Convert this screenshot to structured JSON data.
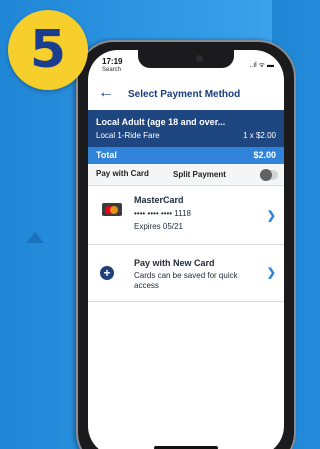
{
  "badge": {
    "number": "5"
  },
  "status": {
    "time": "17:19",
    "back_app": "Search",
    "icons": "..ıl ᯤ ▬"
  },
  "nav": {
    "back_icon": "arrow-left-icon",
    "title": "Select Payment Method"
  },
  "fare": {
    "name": "Local Adult (age 18 and over...",
    "type": "Local 1-Ride Fare",
    "qty_price": "1 x $2.00"
  },
  "total": {
    "label": "Total",
    "amount": "$2.00"
  },
  "payment": {
    "pay_with_card": "Pay with Card",
    "split_payment": "Split Payment",
    "split_enabled": false
  },
  "card": {
    "brand": "MasterCard",
    "number": "•••• •••• •••• 1118",
    "expires": "Expires 05/21",
    "icon": "mastercard-logo-icon"
  },
  "new_card": {
    "title": "Pay with New Card",
    "subtitle": "Cards can be saved for quick access",
    "icon": "plus-circle-icon"
  },
  "colors": {
    "header_blue": "#1e4680",
    "accent_blue": "#2f84d9",
    "badge_yellow": "#f6cf2d",
    "background_blue": "#2e96e3"
  }
}
